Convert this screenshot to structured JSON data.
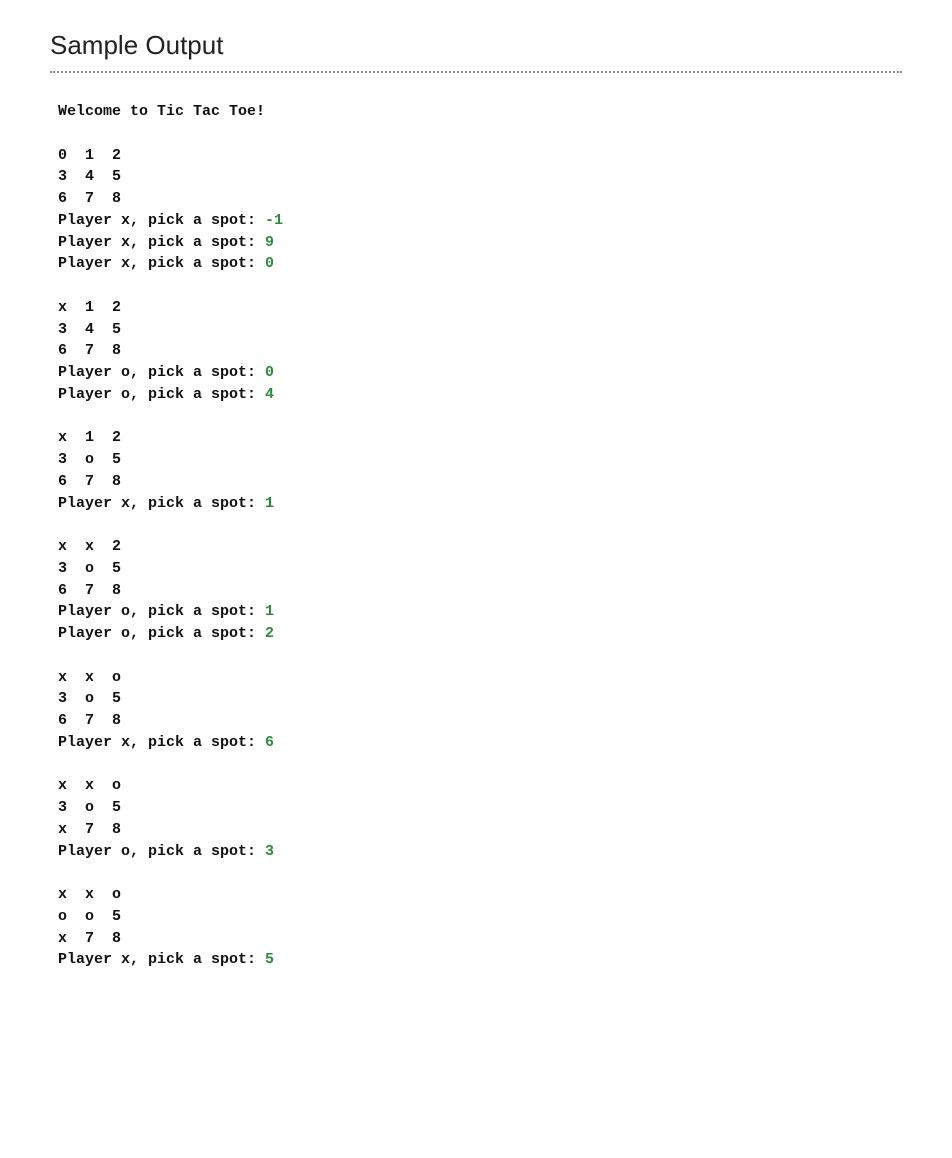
{
  "heading": "Sample Output",
  "colors": {
    "input": "#2e8b3d"
  },
  "lines": [
    {
      "segs": [
        {
          "t": "Welcome to Tic Tac Toe!"
        }
      ]
    },
    {
      "segs": []
    },
    {
      "segs": [
        {
          "t": "0  1  2"
        }
      ]
    },
    {
      "segs": [
        {
          "t": "3  4  5"
        }
      ]
    },
    {
      "segs": [
        {
          "t": "6  7  8"
        }
      ]
    },
    {
      "segs": [
        {
          "t": "Player x, pick a spot: "
        },
        {
          "t": "-1",
          "c": "inp"
        }
      ]
    },
    {
      "segs": [
        {
          "t": "Player x, pick a spot: "
        },
        {
          "t": "9",
          "c": "inp"
        }
      ]
    },
    {
      "segs": [
        {
          "t": "Player x, pick a spot: "
        },
        {
          "t": "0",
          "c": "inp"
        }
      ]
    },
    {
      "segs": []
    },
    {
      "segs": [
        {
          "t": "x  1  2"
        }
      ]
    },
    {
      "segs": [
        {
          "t": "3  4  5"
        }
      ]
    },
    {
      "segs": [
        {
          "t": "6  7  8"
        }
      ]
    },
    {
      "segs": [
        {
          "t": "Player o, pick a spot: "
        },
        {
          "t": "0",
          "c": "inp"
        }
      ]
    },
    {
      "segs": [
        {
          "t": "Player o, pick a spot: "
        },
        {
          "t": "4",
          "c": "inp"
        }
      ]
    },
    {
      "segs": []
    },
    {
      "segs": [
        {
          "t": "x  1  2"
        }
      ]
    },
    {
      "segs": [
        {
          "t": "3  o  5"
        }
      ]
    },
    {
      "segs": [
        {
          "t": "6  7  8"
        }
      ]
    },
    {
      "segs": [
        {
          "t": "Player x, pick a spot: "
        },
        {
          "t": "1",
          "c": "inp"
        }
      ]
    },
    {
      "segs": []
    },
    {
      "segs": [
        {
          "t": "x  x  2"
        }
      ]
    },
    {
      "segs": [
        {
          "t": "3  o  5"
        }
      ]
    },
    {
      "segs": [
        {
          "t": "6  7  8"
        }
      ]
    },
    {
      "segs": [
        {
          "t": "Player o, pick a spot: "
        },
        {
          "t": "1",
          "c": "inp"
        }
      ]
    },
    {
      "segs": [
        {
          "t": "Player o, pick a spot: "
        },
        {
          "t": "2",
          "c": "inp"
        }
      ]
    },
    {
      "segs": []
    },
    {
      "segs": [
        {
          "t": "x  x  o"
        }
      ]
    },
    {
      "segs": [
        {
          "t": "3  o  5"
        }
      ]
    },
    {
      "segs": [
        {
          "t": "6  7  8"
        }
      ]
    },
    {
      "segs": [
        {
          "t": "Player x, pick a spot: "
        },
        {
          "t": "6",
          "c": "inp"
        }
      ]
    },
    {
      "segs": []
    },
    {
      "segs": [
        {
          "t": "x  x  o"
        }
      ]
    },
    {
      "segs": [
        {
          "t": "3  o  5"
        }
      ]
    },
    {
      "segs": [
        {
          "t": "x  7  8"
        }
      ]
    },
    {
      "segs": [
        {
          "t": "Player o, pick a spot: "
        },
        {
          "t": "3",
          "c": "inp"
        }
      ]
    },
    {
      "segs": []
    },
    {
      "segs": [
        {
          "t": "x  x  o"
        }
      ]
    },
    {
      "segs": [
        {
          "t": "o  o  5"
        }
      ]
    },
    {
      "segs": [
        {
          "t": "x  7  8"
        }
      ]
    },
    {
      "segs": [
        {
          "t": "Player x, pick a spot: "
        },
        {
          "t": "5",
          "c": "inp"
        }
      ]
    }
  ]
}
